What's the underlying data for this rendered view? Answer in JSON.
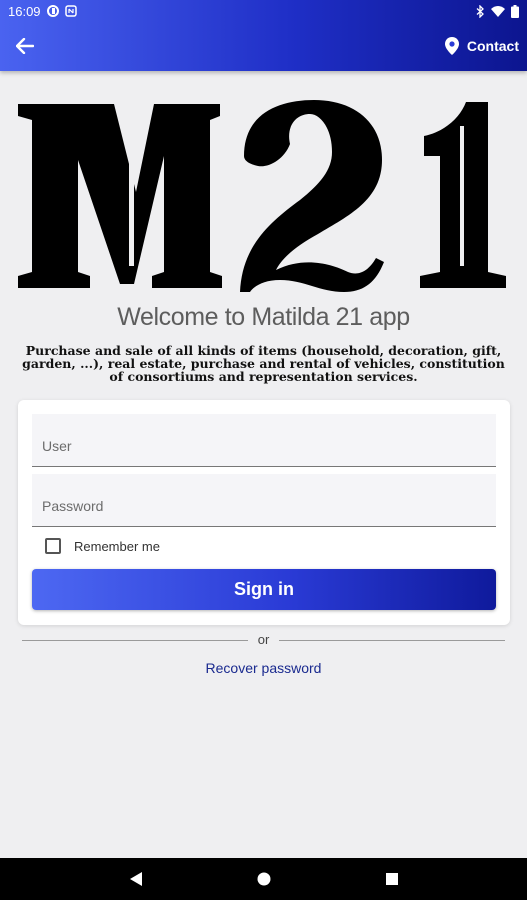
{
  "status_bar": {
    "time": "16:09",
    "left_icons": [
      "data-saver-icon",
      "nfc-icon"
    ],
    "right_icons": [
      "bluetooth-icon",
      "wifi-icon",
      "battery-icon"
    ]
  },
  "app_bar": {
    "back_icon": "arrow-left-icon",
    "contact_label": "Contact",
    "contact_icon": "location-pin-icon",
    "gradient_start": "#4a63f0",
    "gradient_end": "#0c158f"
  },
  "logo": {
    "text": "M21"
  },
  "welcome_title": "Welcome to Matilda 21 app",
  "description": "Purchase and sale of all kinds of items (household, decoration, gift, garden, ...), real estate, purchase and rental of vehicles, constitution of consortiums and representation services.",
  "login_form": {
    "user_placeholder": "User",
    "user_value": "",
    "password_placeholder": "Password",
    "password_value": "",
    "remember_label": "Remember me",
    "remember_checked": false,
    "signin_label": "Sign in"
  },
  "or_label": "or",
  "recover_label": "Recover password",
  "nav_bar": {
    "buttons": [
      "back-triangle-icon",
      "home-circle-icon",
      "recents-square-icon"
    ]
  }
}
